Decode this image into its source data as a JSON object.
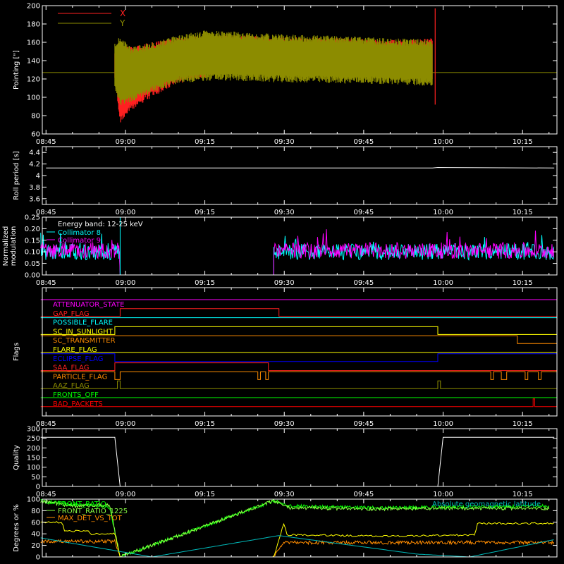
{
  "chart_data": [
    {
      "type": "line",
      "ylabel": "Pointing [\"]",
      "ylim": [
        60,
        200
      ],
      "yticks": [
        60,
        80,
        100,
        120,
        140,
        160,
        180,
        200
      ],
      "xticks": [
        "08:45",
        "09:00",
        "09:15",
        "09:30",
        "09:45",
        "10:00",
        "10:15"
      ],
      "series": [
        {
          "name": "X",
          "color": "#ff2020",
          "x": [
            "08:58",
            "08:59",
            "09:01",
            "09:05",
            "09:10",
            "09:15",
            "09:20",
            "09:25",
            "09:30",
            "09:35",
            "09:40",
            "09:45",
            "09:50",
            "09:55",
            "09:58"
          ],
          "upper": [
            150,
            160,
            155,
            160,
            165,
            168,
            168,
            167,
            166,
            165,
            165,
            164,
            163,
            163,
            165
          ],
          "lower": [
            120,
            72,
            85,
            100,
            115,
            122,
            126,
            126,
            125,
            124,
            123,
            121,
            121,
            120,
            115
          ]
        },
        {
          "name": "Y",
          "color": "#8c8c00",
          "baseline": 127,
          "x": [
            "08:58",
            "08:59",
            "09:01",
            "09:05",
            "09:10",
            "09:15",
            "09:20",
            "09:25",
            "09:30",
            "09:35",
            "09:40",
            "09:45",
            "09:50",
            "09:55",
            "09:58"
          ],
          "upper": [
            160,
            168,
            155,
            160,
            168,
            173,
            172,
            170,
            169,
            168,
            167,
            166,
            164,
            164,
            162
          ],
          "lower": [
            110,
            90,
            95,
            105,
            115,
            118,
            118,
            117,
            116,
            116,
            115,
            115,
            114,
            113,
            112
          ]
        }
      ]
    },
    {
      "type": "line",
      "ylabel": "Roll period [s]",
      "ylim": [
        3.5,
        4.5
      ],
      "yticks": [
        3.6,
        3.8,
        4.0,
        4.2,
        4.4
      ],
      "xticks": [
        "08:45",
        "09:00",
        "09:15",
        "09:30",
        "09:45",
        "10:00",
        "10:15"
      ],
      "series": [
        {
          "color": "#ffffff",
          "x": [
            "08:45",
            "09:58",
            "09:59",
            "10:21"
          ],
          "y": [
            4.13,
            4.13,
            4.14,
            4.13
          ]
        }
      ]
    },
    {
      "type": "line",
      "ylabel_lines": [
        "Normalized",
        "modulation"
      ],
      "ylim": [
        0,
        0.25
      ],
      "yticks": [
        "0.00",
        "0.05",
        "0.10",
        "0.15",
        "0.20",
        "0.25"
      ],
      "xticks": [
        "08:45",
        "09:00",
        "09:15",
        "09:30",
        "09:45",
        "10:00",
        "10:15"
      ],
      "annotation": "Energy band: 12-25 keV",
      "series": [
        {
          "name": "Collimator 8",
          "color": "#00ffff",
          "active": [
            [
              "08:44",
              "08:59"
            ],
            [
              "09:28",
              "10:21"
            ]
          ],
          "mean": 0.1,
          "zero": 0.0
        },
        {
          "name": "Collimator 9",
          "color": "#ff00ff",
          "active": [
            [
              "08:44",
              "08:59"
            ],
            [
              "09:28",
              "10:21"
            ]
          ],
          "mean": 0.105,
          "zero": 0.0
        }
      ]
    },
    {
      "type": "line",
      "ylabel": "Flags",
      "xticks": [
        "08:45",
        "09:00",
        "09:15",
        "09:30",
        "09:45",
        "10:00",
        "10:15"
      ],
      "series": [
        {
          "name": "ATTENUATOR_STATE",
          "color": "#ff00ff",
          "steps": [
            [
              "08:44",
              1
            ]
          ]
        },
        {
          "name": "GAP_FLAG",
          "color": "#ff2020",
          "steps": [
            [
              "08:44",
              0
            ],
            [
              "08:59",
              1
            ],
            [
              "09:29",
              0
            ]
          ]
        },
        {
          "name": "POSSIBLE_FLARE",
          "color": "#00ffff",
          "steps": [
            [
              "08:44",
              1
            ]
          ]
        },
        {
          "name": "SC_IN_SUNLIGHT",
          "color": "#ffff00",
          "steps": [
            [
              "08:44",
              0
            ],
            [
              "08:58",
              1
            ],
            [
              "09:59",
              0
            ]
          ]
        },
        {
          "name": "SC_TRANSMITTER",
          "color": "#ff8c00",
          "steps": [
            [
              "08:44",
              1
            ],
            [
              "10:14",
              0
            ]
          ]
        },
        {
          "name": "FLARE_FLAG",
          "color": "#ffff00",
          "steps": [
            [
              "08:44",
              0
            ]
          ]
        },
        {
          "name": "ECLIPSE_FLAG",
          "color": "#0000ff",
          "steps": [
            [
              "08:44",
              1
            ],
            [
              "08:58",
              0
            ],
            [
              "09:59",
              1
            ]
          ]
        },
        {
          "name": "SAA_FLAG",
          "color": "#ff2020",
          "steps": [
            [
              "08:44",
              0
            ],
            [
              "08:58",
              1
            ],
            [
              "09:27",
              0
            ]
          ]
        },
        {
          "name": "PARTICLE_FLAG",
          "color": "#ff8c00",
          "steps": [
            [
              "08:44",
              1
            ],
            [
              "08:58",
              0
            ],
            [
              "08:59",
              1
            ],
            [
              "09:25",
              0
            ],
            [
              "09:25.5",
              1
            ],
            [
              "09:26.5",
              0
            ],
            [
              "09:27",
              1
            ],
            [
              "10:09",
              0
            ],
            [
              "10:09.5",
              1
            ],
            [
              "10:11",
              0
            ],
            [
              "10:12",
              1
            ],
            [
              "10:15.5",
              0
            ],
            [
              "10:16",
              1
            ],
            [
              "10:18",
              0
            ],
            [
              "10:18.5",
              1
            ]
          ]
        },
        {
          "name": "AAZ_FLAG",
          "color": "#8c8c00",
          "steps": [
            [
              "08:44",
              0
            ],
            [
              "08:58.5",
              1
            ],
            [
              "08:59",
              0
            ],
            [
              "09:59",
              1
            ],
            [
              "09:59.5",
              0
            ]
          ]
        },
        {
          "name": "FRONTS_OFF",
          "color": "#00ff00",
          "steps": [
            [
              "08:44",
              0
            ]
          ]
        },
        {
          "name": "BAD_PACKETS",
          "color": "#ff0000",
          "steps": [
            [
              "08:44",
              0
            ],
            [
              "10:17",
              1
            ],
            [
              "10:17.3",
              0
            ]
          ]
        }
      ]
    },
    {
      "type": "line",
      "ylabel": "Quality",
      "ylim": [
        0,
        300
      ],
      "yticks": [
        0,
        50,
        100,
        150,
        200,
        250,
        300
      ],
      "xticks": [
        "08:45",
        "09:00",
        "09:15",
        "09:30",
        "09:45",
        "10:00",
        "10:15"
      ],
      "series": [
        {
          "color": "#ffffff",
          "x": [
            "08:44",
            "08:58",
            "08:59",
            "09:59",
            "10:00",
            "10:21"
          ],
          "y": [
            255,
            255,
            0,
            0,
            255,
            255
          ]
        }
      ]
    },
    {
      "type": "line",
      "ylabel": "Degrees or %",
      "ylim": [
        0,
        100
      ],
      "yticks": [
        0,
        20,
        40,
        60,
        80,
        100
      ],
      "annotation": "Absolute geomagnetic latitude",
      "series": [
        {
          "name": "FRONT_RATIO",
          "color": "#00ff00",
          "x": [
            "08:44",
            "08:50",
            "08:57",
            "08:59",
            "09:28",
            "09:31",
            "09:45",
            "10:00",
            "10:20"
          ],
          "y": [
            97,
            92,
            86,
            0,
            97,
            88,
            85,
            86,
            88
          ]
        },
        {
          "name": "FRONT_RATIO_1225",
          "color": "#88ff44",
          "x": [
            "08:44",
            "08:50",
            "08:57",
            "08:59",
            "09:28",
            "09:31",
            "09:45",
            "10:00",
            "10:20"
          ],
          "y": [
            97,
            88,
            90,
            0,
            97,
            85,
            83,
            84,
            84
          ]
        },
        {
          "name": "MAX_DET_VS_TOT",
          "color": "#ff8c00",
          "x": [
            "08:44",
            "08:58",
            "08:59",
            "09:28",
            "09:30",
            "10:21"
          ],
          "y": [
            27,
            27,
            0,
            0,
            25,
            25
          ]
        },
        {
          "color": "#ffff00",
          "x": [
            "08:44",
            "08:48",
            "08:48.5",
            "08:53",
            "08:53.5",
            "08:58",
            "08:59",
            "09:28",
            "09:30",
            "09:30.5",
            "09:50",
            "10:06",
            "10:06.5",
            "10:21"
          ],
          "y": [
            60,
            60,
            45,
            45,
            40,
            40,
            0,
            0,
            60,
            38,
            36,
            38,
            58,
            58
          ]
        },
        {
          "name": "Absolute geomagnetic latitude",
          "color": "#00bbbb",
          "x": [
            "08:44",
            "09:05",
            "09:29",
            "09:55",
            "10:05",
            "10:21"
          ],
          "y": [
            33,
            0,
            37,
            5,
            0,
            30
          ]
        }
      ]
    }
  ]
}
